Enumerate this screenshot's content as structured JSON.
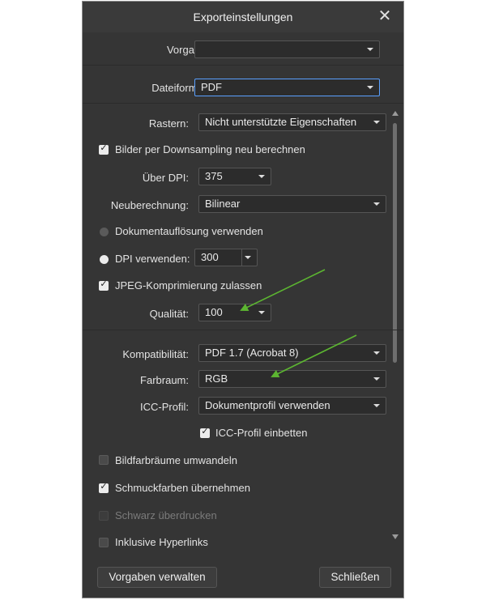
{
  "dialog": {
    "title": "Exporteinstellungen",
    "close_icon": "close-icon"
  },
  "preset": {
    "label": "Vorgabe:",
    "value": ""
  },
  "format": {
    "label": "Dateiformat:",
    "value": "PDF"
  },
  "raster": {
    "label": "Rastern:",
    "value": "Nicht unterstützte Eigenschaften"
  },
  "downsample": {
    "label": "Bilder per Downsampling neu berechnen",
    "checked": true
  },
  "over_dpi": {
    "label": "Über DPI:",
    "value": "375"
  },
  "resample": {
    "label": "Neuberechnung:",
    "value": "Bilinear"
  },
  "doc_resolution": {
    "label": "Dokumentauflösung verwenden",
    "selected": false
  },
  "use_dpi": {
    "label": "DPI verwenden:",
    "value": "300",
    "selected": true
  },
  "jpeg": {
    "label": "JPEG-Komprimierung zulassen",
    "checked": true
  },
  "quality": {
    "label": "Qualität:",
    "value": "100"
  },
  "compat": {
    "label": "Kompatibilität:",
    "value": "PDF 1.7 (Acrobat 8)"
  },
  "colorspace": {
    "label": "Farbraum:",
    "value": "RGB"
  },
  "icc": {
    "label": "ICC-Profil:",
    "value": "Dokumentprofil verwenden"
  },
  "icc_embed": {
    "label": "ICC-Profil einbetten",
    "checked": true
  },
  "convert_image_spaces": {
    "label": "Bildfarbräume umwandeln",
    "checked": false
  },
  "spot_colors": {
    "label": "Schmuckfarben übernehmen",
    "checked": true
  },
  "overprint_black": {
    "label": "Schwarz überdrucken",
    "checked": false,
    "disabled": true
  },
  "hyperlinks": {
    "label": "Inklusive Hyperlinks",
    "checked": false
  },
  "buttons": {
    "manage": "Vorgaben verwalten",
    "close": "Schließen"
  },
  "colors": {
    "dialog_bg": "#353535",
    "annotation_arrow": "#5cb531",
    "focus_border": "#5aa0ff"
  }
}
